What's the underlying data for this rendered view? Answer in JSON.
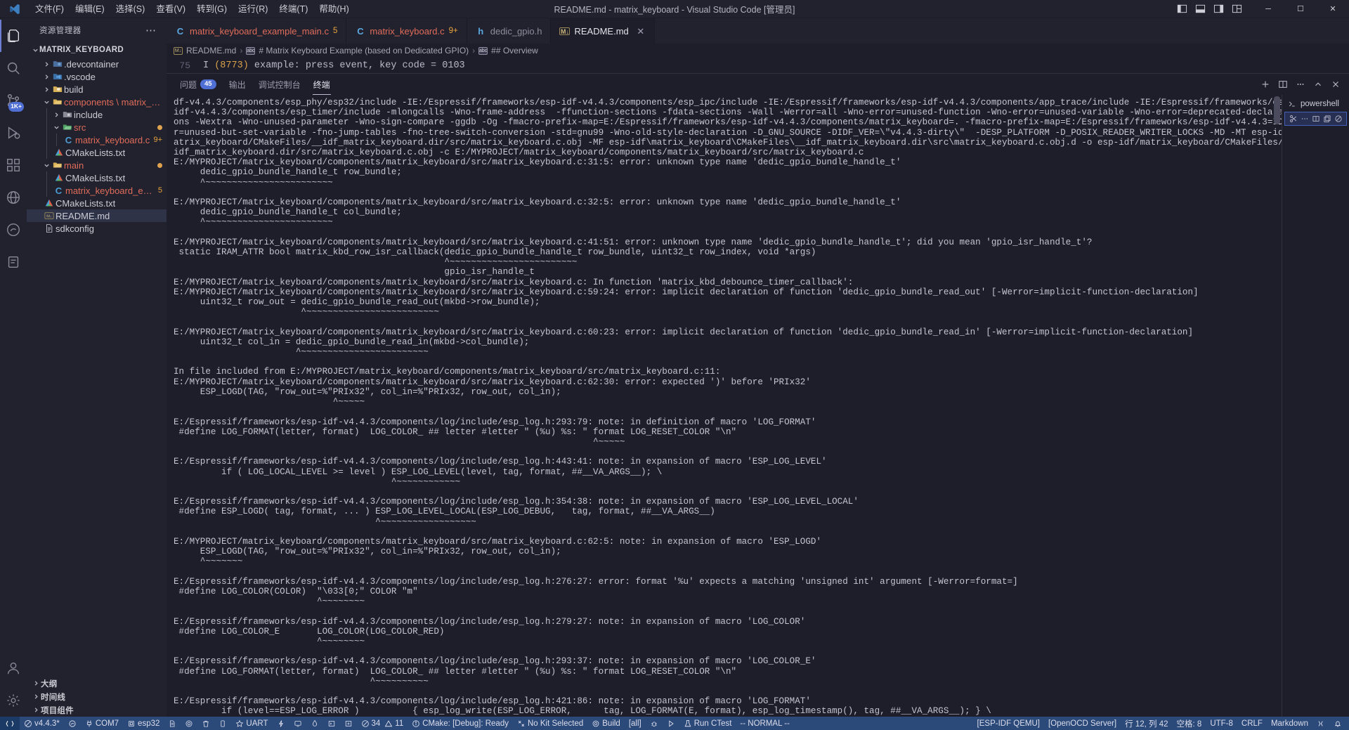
{
  "window": {
    "title": "README.md - matrix_keyboard - Visual Studio Code [管理员]",
    "minimize": "─",
    "maximize": "☐",
    "close": "✕"
  },
  "menubar": [
    {
      "label": "文件(F)"
    },
    {
      "label": "编辑(E)"
    },
    {
      "label": "选择(S)"
    },
    {
      "label": "查看(V)"
    },
    {
      "label": "转到(G)"
    },
    {
      "label": "运行(R)"
    },
    {
      "label": "终端(T)"
    },
    {
      "label": "帮助(H)"
    }
  ],
  "activitybar": {
    "items": [
      {
        "name": "explorer",
        "icon": "files-icon",
        "badge": ""
      },
      {
        "name": "search",
        "icon": "search-icon",
        "badge": ""
      },
      {
        "name": "source-control",
        "icon": "source-control-icon",
        "badge": "1K+"
      },
      {
        "name": "run-debug",
        "icon": "debug-icon",
        "badge": ""
      },
      {
        "name": "extensions",
        "icon": "extensions-icon",
        "badge": ""
      },
      {
        "name": "remote-explorer",
        "icon": "remote-icon",
        "badge": ""
      },
      {
        "name": "espressif",
        "icon": "espressif-icon",
        "badge": ""
      },
      {
        "name": "test",
        "icon": "beaker-icon",
        "badge": ""
      }
    ],
    "bottom": [
      {
        "name": "accounts",
        "icon": "account-icon"
      },
      {
        "name": "settings",
        "icon": "gear-icon"
      }
    ]
  },
  "sidebar": {
    "title": "资源管理器",
    "more": "⋯",
    "root": "MATRIX_KEYBOARD",
    "tree": [
      {
        "label": ".devcontainer",
        "type": "folder",
        "icon": "folder-devcontainer",
        "depth": 1,
        "expanded": false,
        "color": "plain",
        "badge": ""
      },
      {
        "label": ".vscode",
        "type": "folder",
        "icon": "folder-vscode",
        "depth": 1,
        "expanded": false,
        "color": "plain",
        "badge": ""
      },
      {
        "label": "build",
        "type": "folder",
        "icon": "folder-build",
        "depth": 1,
        "expanded": false,
        "color": "plain",
        "badge": ""
      },
      {
        "label": "components \\ matrix_ke...",
        "type": "folder",
        "icon": "folder-open",
        "depth": 1,
        "expanded": true,
        "color": "orange",
        "badge": ""
      },
      {
        "label": "include",
        "type": "folder",
        "icon": "folder-include",
        "depth": 2,
        "expanded": false,
        "color": "plain",
        "badge": ""
      },
      {
        "label": "src",
        "type": "folder",
        "icon": "folder-src",
        "depth": 2,
        "expanded": true,
        "color": "orange",
        "badge": "dot"
      },
      {
        "label": "matrix_keyboard.c",
        "type": "file",
        "icon": "c-file-icon",
        "depth": 3,
        "expanded": null,
        "color": "orange",
        "badge": "9+"
      },
      {
        "label": "CMakeLists.txt",
        "type": "file",
        "icon": "cmake-icon",
        "depth": 2,
        "expanded": null,
        "color": "plain",
        "badge": ""
      },
      {
        "label": "main",
        "type": "folder",
        "icon": "folder-open",
        "depth": 1,
        "expanded": true,
        "color": "orange",
        "badge": "dot"
      },
      {
        "label": "CMakeLists.txt",
        "type": "file",
        "icon": "cmake-icon",
        "depth": 2,
        "expanded": null,
        "color": "plain",
        "badge": ""
      },
      {
        "label": "matrix_keyboard_exam...",
        "type": "file",
        "icon": "c-file-icon",
        "depth": 2,
        "expanded": null,
        "color": "orange",
        "badge": "5"
      },
      {
        "label": "CMakeLists.txt",
        "type": "file",
        "icon": "cmake-icon",
        "depth": 1,
        "expanded": null,
        "color": "plain",
        "badge": ""
      },
      {
        "label": "README.md",
        "type": "file",
        "icon": "md-icon",
        "depth": 1,
        "expanded": null,
        "color": "plain",
        "badge": "",
        "selected": true
      },
      {
        "label": "sdkconfig",
        "type": "file",
        "icon": "config-icon",
        "depth": 1,
        "expanded": null,
        "color": "plain",
        "badge": ""
      }
    ],
    "sections": [
      {
        "label": "大纲"
      },
      {
        "label": "时间线"
      },
      {
        "label": "项目组件"
      }
    ]
  },
  "tabs": [
    {
      "label": "matrix_keyboard_example_main.c",
      "icon": "C",
      "icon_color": "blue",
      "count": "5",
      "active": false,
      "close": ""
    },
    {
      "label": "matrix_keyboard.c",
      "icon": "C",
      "icon_color": "blue",
      "count": "9+",
      "active": false,
      "close": ""
    },
    {
      "label": "dedic_gpio.h",
      "icon": "h",
      "icon_color": "blue",
      "count": "",
      "active": false,
      "close": ""
    },
    {
      "label": "README.md",
      "icon": "M↓",
      "icon_color": "md",
      "count": "",
      "active": true,
      "close": "✕"
    }
  ],
  "breadcrumbs": [
    {
      "label": "README.md",
      "icon": "md-icon"
    },
    {
      "label": "# Matrix Keyboard Example (based on Dedicated GPIO)",
      "icon": "symbol-string-icon"
    },
    {
      "label": "## Overview",
      "icon": "symbol-string-icon"
    }
  ],
  "editor": {
    "line_number": "75",
    "code_prefix": "I ",
    "code_paren": "(8773)",
    "code_suffix": " example: press event, key code = 0103"
  },
  "panel": {
    "tabs": [
      {
        "label": "问题",
        "badge": "45",
        "active": false
      },
      {
        "label": "输出",
        "badge": "",
        "active": false
      },
      {
        "label": "调试控制台",
        "badge": "",
        "active": false
      },
      {
        "label": "终端",
        "badge": "",
        "active": true
      }
    ],
    "actions": [
      {
        "name": "new-terminal-icon",
        "glyph": "+"
      },
      {
        "name": "split-terminal-icon",
        "glyph": "⌷"
      },
      {
        "name": "more-actions-icon",
        "glyph": "⋯"
      },
      {
        "name": "maximize-panel-icon",
        "glyph": "⌃"
      },
      {
        "name": "close-panel-icon",
        "glyph": "✕"
      }
    ],
    "terminal_list": [
      {
        "label": "powershell",
        "icon": "terminal-icon",
        "selected": false
      }
    ],
    "terminal_item_actions": [
      {
        "name": "kill-terminal-icon",
        "glyph": "✂"
      },
      {
        "name": "terminal-more-icon",
        "glyph": "⋯"
      },
      {
        "name": "split-icon",
        "glyph": "⌷"
      },
      {
        "name": "copy-icon",
        "glyph": "⧉"
      },
      {
        "name": "trash-icon",
        "glyph": "⊗"
      }
    ],
    "terminal_output": "df-v4.4.3/components/esp_phy/esp32/include -IE:/Espressif/frameworks/esp-idf-v4.4.3/components/esp_ipc/include -IE:/Espressif/frameworks/esp-idf-v4.4.3/components/app_trace/include -IE:/Espressif/frameworks/esp-\nidf-v4.4.3/components/esp_timer/include -mlongcalls -Wno-frame-address  -ffunction-sections -fdata-sections -Wall -Werror=all -Wno-error=unused-function -Wno-error=unused-variable -Wno-error=deprecated-declarati\nons -Wextra -Wno-unused-parameter -Wno-sign-compare -ggdb -Og -fmacro-prefix-map=E:/Espressif/frameworks/esp-idf-v4.4.3/components/matrix_keyboard=. -fmacro-prefix-map=E:/Espressif/frameworks/esp-idf-v4.4.3=IDF  -fstrict-volatile-bitfields -Wno-erro\nr=unused-but-set-variable -fno-jump-tables -fno-tree-switch-conversion -std=gnu99 -Wno-old-style-declaration -D_GNU_SOURCE -DIDF_VER=\\\"v4.4.3-dirty\\\"  -DESP_PLATFORM -D_POSIX_READER_WRITER_LOCKS -MD -MT esp-idf/m\natrix_keyboard/CMakeFiles/__idf_matrix_keyboard.dir/src/matrix_keyboard.c.obj -MF esp-idf\\matrix_keyboard\\CMakeFiles\\__idf_matrix_keyboard.dir\\src\\matrix_keyboard.c.obj.d -o esp-idf/matrix_keyboard/CMakeFiles/__\nidf_matrix_keyboard.dir/src/matrix_keyboard.c.obj -c E:/MYPROJECT/matrix_keyboard/components/matrix_keyboard/src/matrix_keyboard.c\nE:/MYPROJECT/matrix_keyboard/components/matrix_keyboard/src/matrix_keyboard.c:31:5: error: unknown type name 'dedic_gpio_bundle_handle_t'\n     dedic_gpio_bundle_handle_t row_bundle;\n     ^~~~~~~~~~~~~~~~~~~~~~~~~\n\nE:/MYPROJECT/matrix_keyboard/components/matrix_keyboard/src/matrix_keyboard.c:32:5: error: unknown type name 'dedic_gpio_bundle_handle_t'\n     dedic_gpio_bundle_handle_t col_bundle;\n     ^~~~~~~~~~~~~~~~~~~~~~~~~\n\nE:/MYPROJECT/matrix_keyboard/components/matrix_keyboard/src/matrix_keyboard.c:41:51: error: unknown type name 'dedic_gpio_bundle_handle_t'; did you mean 'gpio_isr_handle_t'?\n static IRAM_ATTR bool matrix_kbd_row_isr_callback(dedic_gpio_bundle_handle_t row_bundle, uint32_t row_index, void *args)\n                                                   ^~~~~~~~~~~~~~~~~~~~~~~~~\n                                                   gpio_isr_handle_t\nE:/MYPROJECT/matrix_keyboard/components/matrix_keyboard/src/matrix_keyboard.c: In function 'matrix_kbd_debounce_timer_callback':\nE:/MYPROJECT/matrix_keyboard/components/matrix_keyboard/src/matrix_keyboard.c:59:24: error: implicit declaration of function 'dedic_gpio_bundle_read_out' [-Werror=implicit-function-declaration]\n     uint32_t row_out = dedic_gpio_bundle_read_out(mkbd->row_bundle);\n                        ^~~~~~~~~~~~~~~~~~~~~~~~~~\n\nE:/MYPROJECT/matrix_keyboard/components/matrix_keyboard/src/matrix_keyboard.c:60:23: error: implicit declaration of function 'dedic_gpio_bundle_read_in' [-Werror=implicit-function-declaration]\n     uint32_t col_in = dedic_gpio_bundle_read_in(mkbd->col_bundle);\n                       ^~~~~~~~~~~~~~~~~~~~~~~~~\n\nIn file included from E:/MYPROJECT/matrix_keyboard/components/matrix_keyboard/src/matrix_keyboard.c:11:\nE:/MYPROJECT/matrix_keyboard/components/matrix_keyboard/src/matrix_keyboard.c:62:30: error: expected ')' before 'PRIx32'\n     ESP_LOGD(TAG, \"row_out=%\"PRIx32\", col_in=%\"PRIx32, row_out, col_in);\n                              ^~~~~~\n\nE:/Espressif/frameworks/esp-idf-v4.4.3/components/log/include/esp_log.h:293:79: note: in definition of macro 'LOG_FORMAT'\n #define LOG_FORMAT(letter, format)  LOG_COLOR_ ## letter #letter \" (%u) %s: \" format LOG_RESET_COLOR \"\\n\"\n                                                                               ^~~~~~\n\nE:/Espressif/frameworks/esp-idf-v4.4.3/components/log/include/esp_log.h:443:41: note: in expansion of macro 'ESP_LOG_LEVEL'\n         if ( LOG_LOCAL_LEVEL >= level ) ESP_LOG_LEVEL(level, tag, format, ##__VA_ARGS__); \\\n                                         ^~~~~~~~~~~~~\n\nE:/Espressif/frameworks/esp-idf-v4.4.3/components/log/include/esp_log.h:354:38: note: in expansion of macro 'ESP_LOG_LEVEL_LOCAL'\n #define ESP_LOGD( tag, format, ... ) ESP_LOG_LEVEL_LOCAL(ESP_LOG_DEBUG,   tag, format, ##__VA_ARGS__)\n                                      ^~~~~~~~~~~~~~~~~~~\n\nE:/MYPROJECT/matrix_keyboard/components/matrix_keyboard/src/matrix_keyboard.c:62:5: note: in expansion of macro 'ESP_LOGD'\n     ESP_LOGD(TAG, \"row_out=%\"PRIx32\", col_in=%\"PRIx32, row_out, col_in);\n     ^~~~~~~~\n\nE:/Espressif/frameworks/esp-idf-v4.4.3/components/log/include/esp_log.h:276:27: error: format '%u' expects a matching 'unsigned int' argument [-Werror=format=]\n #define LOG_COLOR(COLOR)  \"\\033[0;\" COLOR \"m\"\n                           ^~~~~~~~~\n\nE:/Espressif/frameworks/esp-idf-v4.4.3/components/log/include/esp_log.h:279:27: note: in expansion of macro 'LOG_COLOR'\n #define LOG_COLOR_E       LOG_COLOR(LOG_COLOR_RED)\n                           ^~~~~~~~~\n\nE:/Espressif/frameworks/esp-idf-v4.4.3/components/log/include/esp_log.h:293:37: note: in expansion of macro 'LOG_COLOR_E'\n #define LOG_FORMAT(letter, format)  LOG_COLOR_ ## letter #letter \" (%u) %s: \" format LOG_RESET_COLOR \"\\n\"\n                                     ^~~~~~~~~~~\n\nE:/Espressif/frameworks/esp-idf-v4.4.3/components/log/include/esp_log.h:421:86: note: in expansion of macro 'LOG_FORMAT'\n         if (level==ESP_LOG_ERROR )          { esp_log_write(ESP_LOG_ERROR,      tag, LOG_FORMAT(E, format), esp_log_timestamp(), tag, ##__VA_ARGS__); } \\"
  },
  "statusbar": {
    "left": [
      {
        "name": "remote-indicator",
        "icon": "remote-icon",
        "label": ""
      },
      {
        "name": "idf-version",
        "icon": "circle-slash-icon",
        "label": "v4.4.3*"
      },
      {
        "name": "idf-set-target",
        "icon": "circuit-icon",
        "label": ""
      },
      {
        "name": "serial-port",
        "icon": "plug-icon",
        "label": "COM7"
      },
      {
        "name": "idf-target",
        "icon": "chip-icon",
        "label": "esp32"
      },
      {
        "name": "idf-menuconfig",
        "icon": "gear-cog-icon",
        "label": ""
      },
      {
        "name": "idf-build",
        "icon": "settings-icon",
        "label": ""
      },
      {
        "name": "idf-fullclean",
        "icon": "trash-icon",
        "label": ""
      },
      {
        "name": "idf-device",
        "icon": "device-icon",
        "label": ""
      },
      {
        "name": "idf-monitor",
        "icon": "star-icon",
        "label": "UART"
      },
      {
        "name": "idf-flash",
        "icon": "zap-icon",
        "label": ""
      },
      {
        "name": "idf-monitor-device",
        "icon": "monitor-icon",
        "label": ""
      },
      {
        "name": "idf-debug",
        "icon": "flame-icon",
        "label": ""
      },
      {
        "name": "idf-terminal",
        "icon": "terminal-box-icon",
        "label": ""
      },
      {
        "name": "idf-add",
        "icon": "add-box-icon",
        "label": ""
      },
      {
        "name": "errors",
        "icon": "error-icon",
        "label": "34"
      },
      {
        "name": "warnings",
        "icon": "warning-icon",
        "label": "11"
      },
      {
        "name": "cmake-status",
        "icon": "info-icon",
        "label": "CMake: [Debug]: Ready"
      },
      {
        "name": "cmake-kit",
        "icon": "tools-icon",
        "label": "No Kit Selected"
      },
      {
        "name": "cmake-build",
        "icon": "gear-icon",
        "label": "Build"
      },
      {
        "name": "cmake-target",
        "icon": "",
        "label": "[all]"
      },
      {
        "name": "cmake-debug",
        "icon": "bug-icon",
        "label": ""
      },
      {
        "name": "cmake-launch",
        "icon": "play-icon",
        "label": ""
      },
      {
        "name": "run-ctest",
        "icon": "beaker-icon",
        "label": "Run CTest"
      },
      {
        "name": "vim-mode",
        "icon": "",
        "label": "-- NORMAL --"
      }
    ],
    "right": [
      {
        "name": "esp-idf-qemu",
        "icon": "",
        "label": "[ESP-IDF QEMU]"
      },
      {
        "name": "openocd-server",
        "icon": "",
        "label": "[OpenOCD Server]"
      },
      {
        "name": "cursor-position",
        "icon": "",
        "label": "行 12, 列 42"
      },
      {
        "name": "indentation",
        "icon": "",
        "label": "空格: 8"
      },
      {
        "name": "encoding",
        "icon": "",
        "label": "UTF-8"
      },
      {
        "name": "eol",
        "icon": "",
        "label": "CRLF"
      },
      {
        "name": "language-mode",
        "icon": "",
        "label": "Markdown"
      },
      {
        "name": "feedback",
        "icon": "smiley-icon",
        "label": ""
      },
      {
        "name": "notifications",
        "icon": "bell-icon",
        "label": ""
      }
    ]
  },
  "colors": {
    "accent": "#4f6fd4",
    "statusbar": "#2b4a7a",
    "modified": "#e0a44f",
    "error": "#e06c5a"
  }
}
